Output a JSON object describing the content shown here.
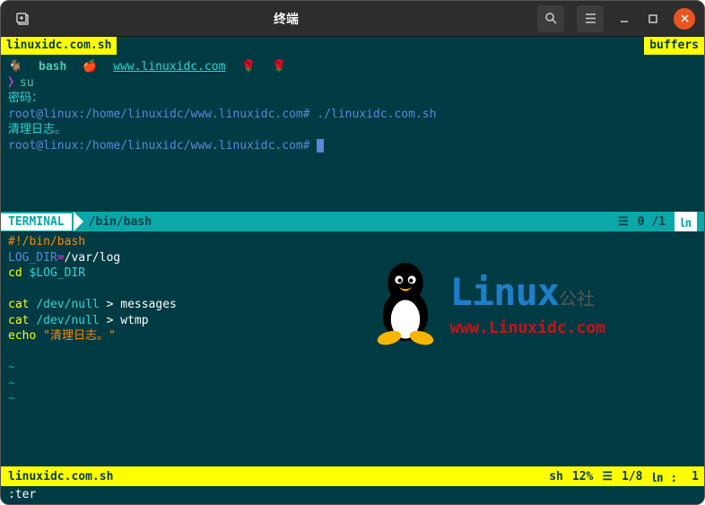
{
  "window": {
    "title": "终端"
  },
  "tabs": {
    "left": "linuxidc.com.sh",
    "right": "buffers"
  },
  "pane1": {
    "bash_label": "bash",
    "url": "www.linuxidc.com",
    "su_prompt": "〉",
    "su_cmd": "su",
    "password": "密码：",
    "root_prompt1": "root@linux:/home/linuxidc/www.linuxidc.com#",
    "script_cmd": "./linuxidc.com.sh",
    "echo_out": "清理日志。",
    "root_prompt2": "root@linux:/home/linuxidc/www.linuxidc.com#"
  },
  "status1": {
    "mode": "TERMINAL",
    "path": "/bin/bash",
    "hamburger": "☰",
    "pos": "0",
    "total": "/1",
    "ln": "㏑"
  },
  "pane2": {
    "shebang": "#!/bin/bash",
    "var": "LOG_DIR",
    "eq": "=",
    "varval": "/var/log",
    "cd": "cd ",
    "cdvar": "$LOG_DIR",
    "cat1a": "cat ",
    "cat1b": "/dev/null",
    "cat1c": " > messages",
    "cat2a": "cat ",
    "cat2b": "/dev/null",
    "cat2c": " > wtmp",
    "echo": "echo ",
    "echostr": "\"清理日志。\"",
    "tilde": "~"
  },
  "status2": {
    "file": "linuxidc.com.sh",
    "ft": "sh",
    "pct": "12%",
    "hamburger": "☰",
    "pos": "1/8",
    "ln": "㏑ :",
    "col": "1"
  },
  "cmdline": ":ter",
  "watermark": {
    "linux": "Linux",
    "gongsi": "公社",
    "url": "www.Linuxidc.com"
  }
}
